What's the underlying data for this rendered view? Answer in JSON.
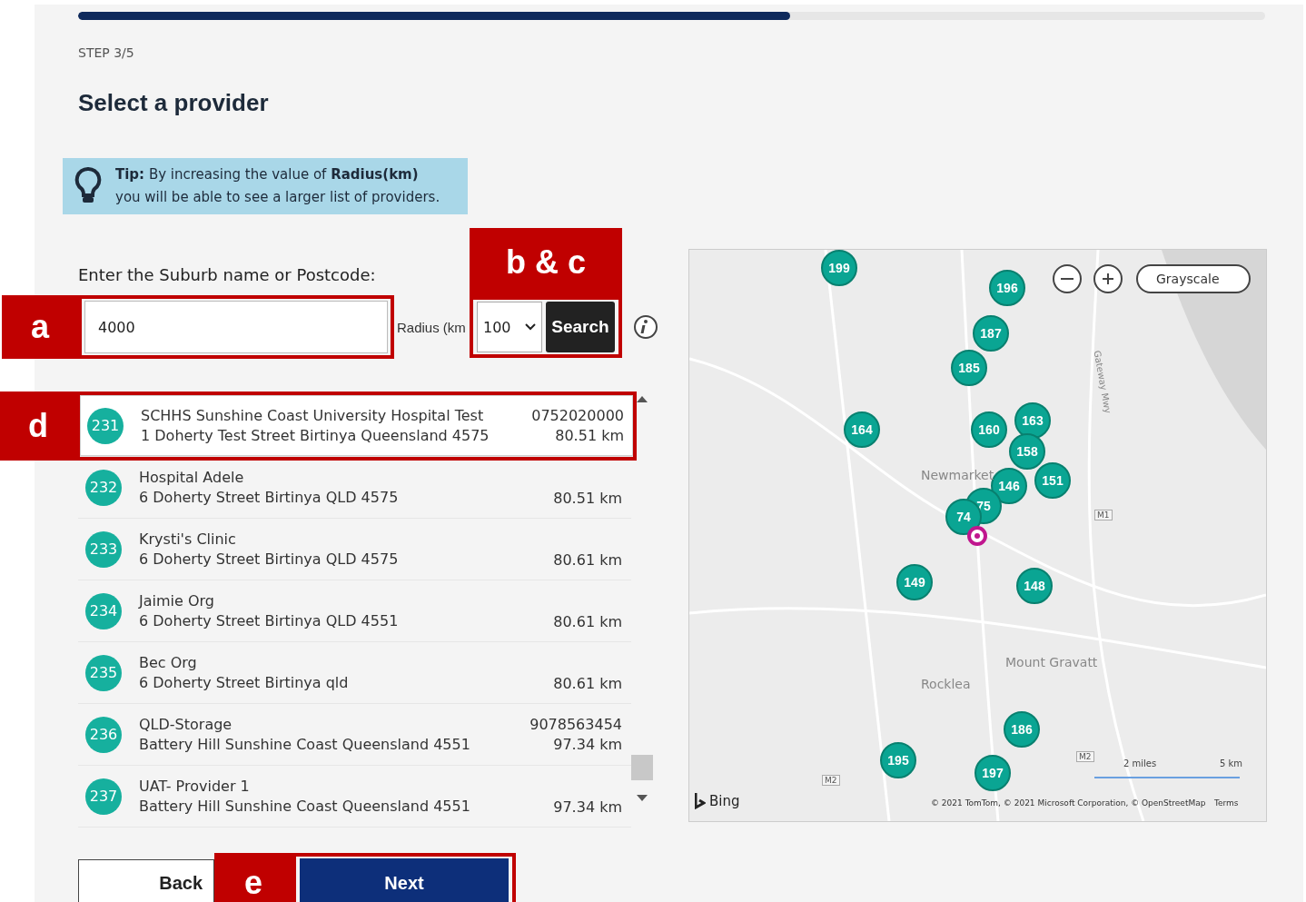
{
  "progress": {
    "level": 0.6
  },
  "step": "STEP 3/5",
  "title": "Select a provider",
  "tip": {
    "text": "**Tip:** By increasing the value of **Radius(km)**\nyou will be able to see a larger list of providers."
  },
  "search": {
    "label": "Enter the Suburb name or Postcode:",
    "value": "4000",
    "radius_label": "Radius (km",
    "radius_value": "100",
    "button": "Search"
  },
  "providers": [
    {
      "number": "231",
      "name": "SCHHS Sunshine Coast University Hospital Test",
      "address": "1 Doherty Test Street Birtinya Queensland 4575",
      "phone": "0752020000",
      "distance": "80.51 km",
      "selected": true
    },
    {
      "number": "232",
      "name": "Hospital Adele",
      "address": "6 Doherty Street Birtinya QLD 4575",
      "distance": "80.51 km",
      "selected": false
    },
    {
      "number": "233",
      "name": "Krysti's Clinic",
      "address": "6 Doherty Street Birtinya QLD 4575",
      "distance": "80.61 km",
      "selected": false
    },
    {
      "number": "234",
      "name": "Jaimie Org",
      "address": "6 Doherty Street Birtinya QLD 4551",
      "distance": "80.61 km",
      "selected": false
    },
    {
      "number": "235",
      "name": "Bec Org",
      "address": "6 Doherty Street Birtinya qld",
      "distance": "80.61 km",
      "selected": false
    },
    {
      "number": "236",
      "name": "QLD-Storage",
      "address": "Battery Hill Sunshine Coast Queensland 4551",
      "phone": "9078563454",
      "distance": "97.34 km",
      "selected": false
    },
    {
      "number": "237",
      "name": "UAT- Provider 1",
      "address": "Battery Hill Sunshine Coast Queensland 4551",
      "distance": "97.34 km",
      "selected": false
    }
  ],
  "map": {
    "style_button": "Grayscale",
    "places": [
      "Newmarket",
      "Mount Gravatt",
      "Rocklea"
    ],
    "roads": [
      "M1",
      "M2",
      "M2",
      "Gateway Mwy"
    ],
    "markers": [
      "199",
      "196",
      "187",
      "185",
      "164",
      "160",
      "163",
      "158",
      "146",
      "151",
      "75",
      "74",
      "149",
      "148",
      "186",
      "195",
      "197"
    ],
    "scale": [
      "2 miles",
      "5 km"
    ],
    "brand": "Bing",
    "copyright": "© 2021 TomTom, © 2021 Microsoft Corporation, © OpenStreetMap",
    "terms": "Terms"
  },
  "buttons": {
    "back": "Back",
    "next": "Next"
  },
  "annotations": [
    {
      "label": "a"
    },
    {
      "label": "b & c"
    },
    {
      "label": "d"
    },
    {
      "label": "e"
    }
  ]
}
